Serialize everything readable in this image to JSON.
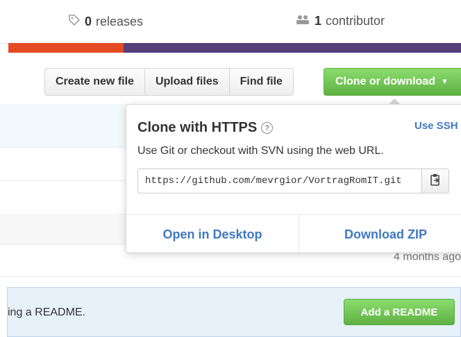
{
  "summary": {
    "releases_count": "0",
    "releases_label": "releases",
    "contributors_count": "1",
    "contributors_label": "contributor"
  },
  "language_bar": {
    "colors": [
      "#e44b23",
      "#563d7c"
    ]
  },
  "toolbar": {
    "create_label": "Create new file",
    "upload_label": "Upload files",
    "find_label": "Find file",
    "clone_label": "Clone or download"
  },
  "clone_popover": {
    "title": "Clone with HTTPS",
    "use_ssh": "Use SSH",
    "description": "Use Git or checkout with SVN using the web URL.",
    "url": "https://github.com/mevrgior/VortragRomIT.git",
    "open_desktop": "Open in Desktop",
    "download_zip": "Download ZIP"
  },
  "file_list": {
    "last_age": "4 months ago"
  },
  "readme_banner": {
    "text": "ing a README.",
    "button": "Add a README"
  },
  "colors": {
    "green": "#60b044",
    "link": "#4078c0",
    "banner": "#e6f1fa"
  },
  "icons": {
    "releases": "tag-icon",
    "contributors": "people-icon",
    "help": "question-icon",
    "copy": "clipboard-icon",
    "dropdown": "caret-down-icon"
  }
}
